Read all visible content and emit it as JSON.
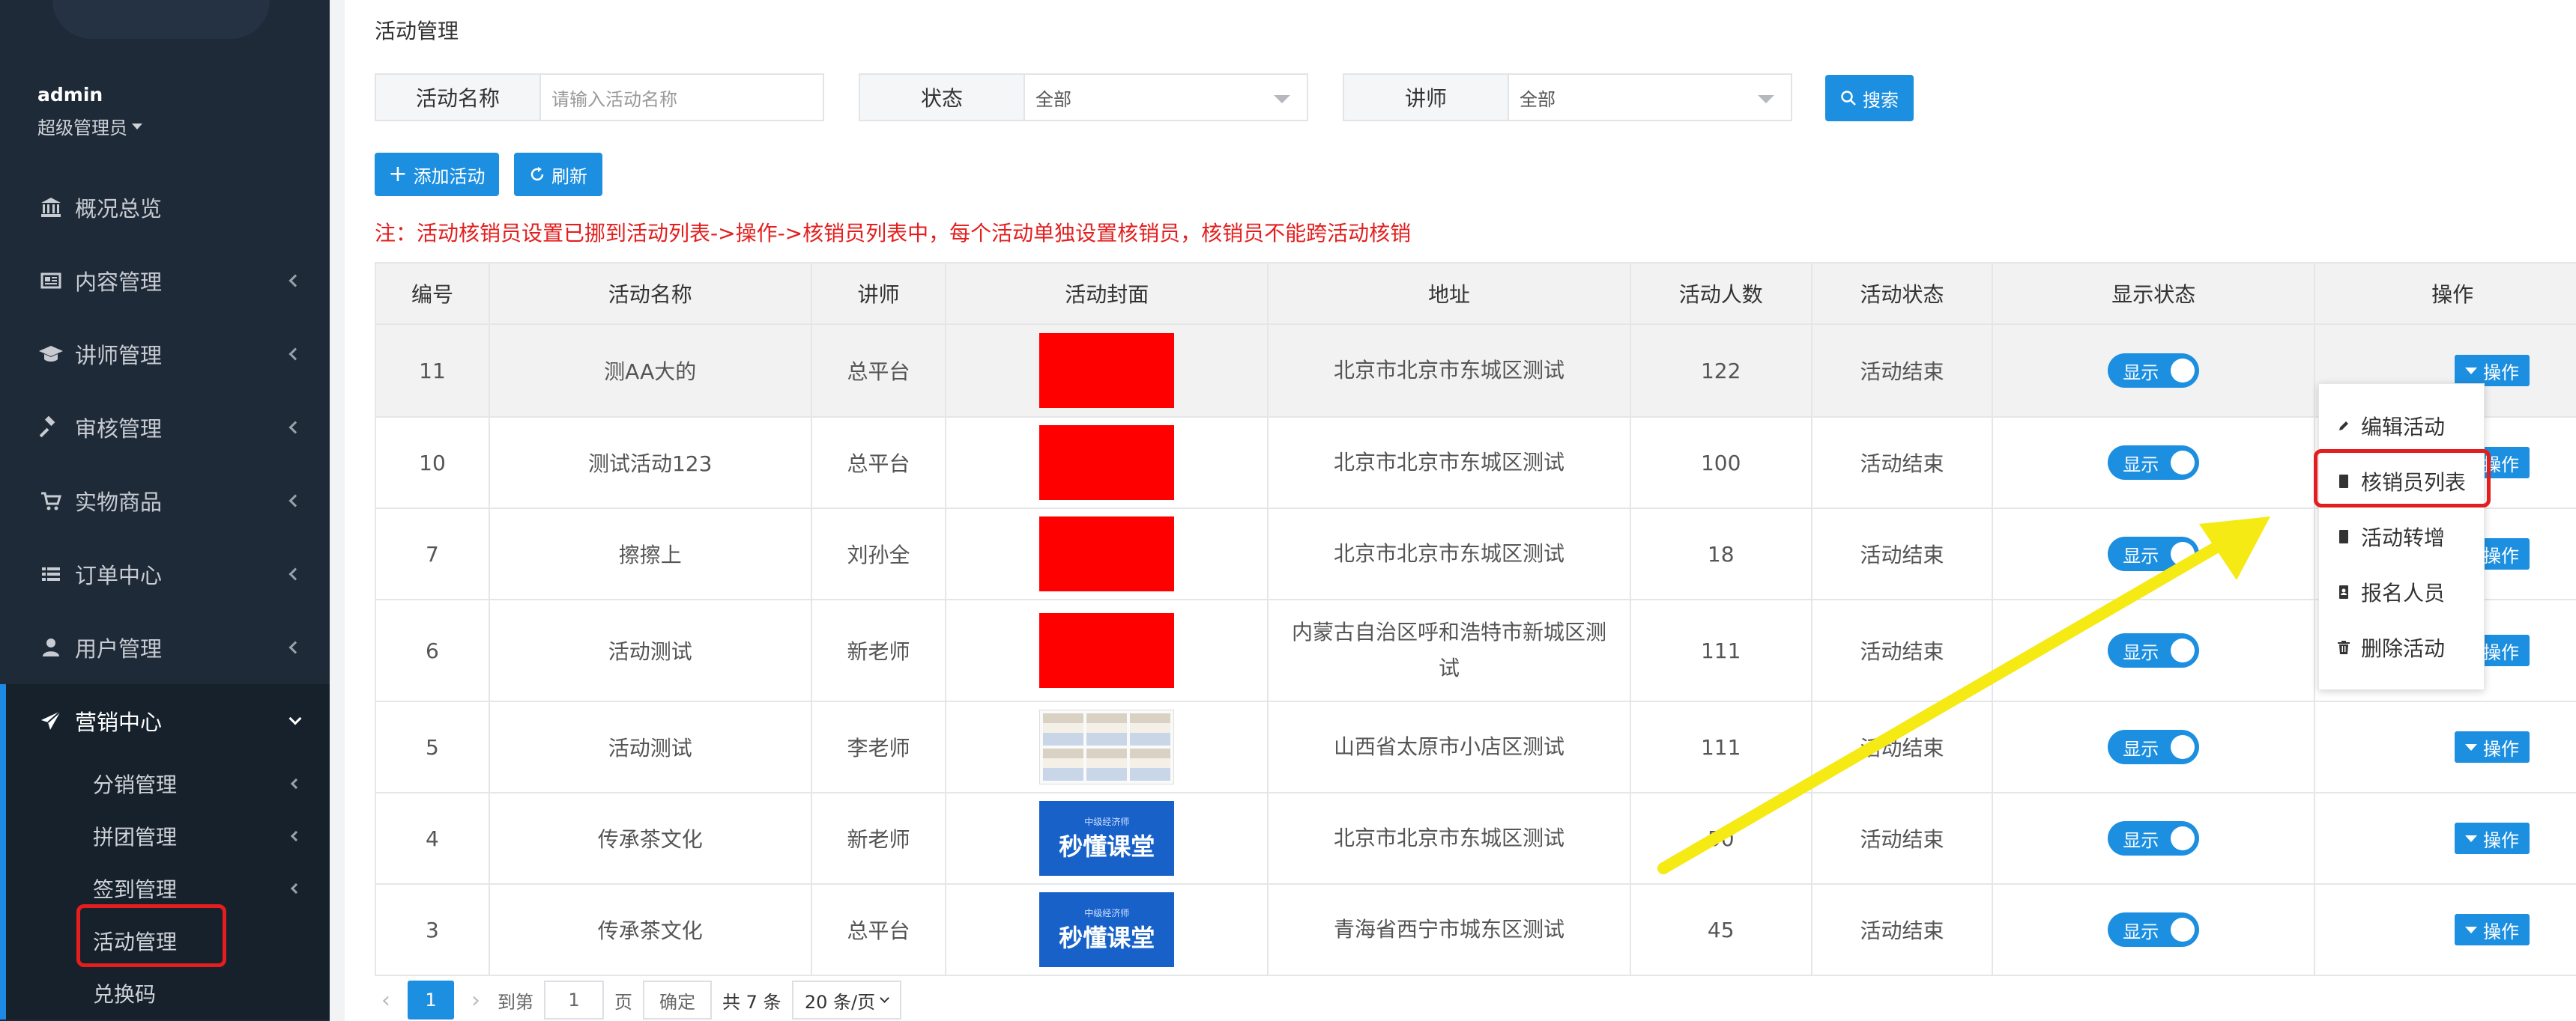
{
  "sidebar": {
    "user": {
      "name": "admin",
      "role": "超级管理员"
    },
    "items": [
      {
        "label": "概况总览",
        "icon": "bank-icon"
      },
      {
        "label": "内容管理",
        "icon": "newspaper-icon"
      },
      {
        "label": "讲师管理",
        "icon": "graduation-cap-icon"
      },
      {
        "label": "审核管理",
        "icon": "gavel-icon"
      },
      {
        "label": "实物商品",
        "icon": "cart-icon"
      },
      {
        "label": "订单中心",
        "icon": "list-icon"
      },
      {
        "label": "用户管理",
        "icon": "user-icon"
      },
      {
        "label": "营销中心",
        "icon": "paper-plane-icon"
      }
    ],
    "sub_items": [
      {
        "label": "分销管理"
      },
      {
        "label": "拼团管理"
      },
      {
        "label": "签到管理"
      },
      {
        "label": "活动管理"
      },
      {
        "label": "兑换码"
      }
    ]
  },
  "page": {
    "title": "活动管理",
    "filters": {
      "name_label": "活动名称",
      "name_placeholder": "请输入活动名称",
      "status_label": "状态",
      "status_value": "全部",
      "lecturer_label": "讲师",
      "lecturer_value": "全部",
      "search_label": "搜索"
    },
    "toolbar": {
      "add_label": "添加活动",
      "refresh_label": "刷新"
    },
    "note": "注：活动核销员设置已挪到活动列表->操作->核销员列表中，每个活动单独设置核销员，核销员不能跨活动核销"
  },
  "table": {
    "headers": [
      "编号",
      "活动名称",
      "讲师",
      "活动封面",
      "地址",
      "活动人数",
      "活动状态",
      "显示状态",
      "操作"
    ],
    "rows": [
      {
        "id": "11",
        "name": "测AA大的",
        "lecturer": "总平台",
        "cover": "red",
        "address": "北京市北京市东城区测试",
        "count": "122",
        "status": "活动结束",
        "display": "显示",
        "op": "操作"
      },
      {
        "id": "10",
        "name": "测试活动123",
        "lecturer": "总平台",
        "cover": "red",
        "address": "北京市北京市东城区测试",
        "count": "100",
        "status": "活动结束",
        "display": "显示",
        "op": "操作"
      },
      {
        "id": "7",
        "name": "擦擦上",
        "lecturer": "刘孙全",
        "cover": "red",
        "address": "北京市北京市东城区测试",
        "count": "18",
        "status": "活动结束",
        "display": "显示",
        "op": "操作"
      },
      {
        "id": "6",
        "name": "活动测试",
        "lecturer": "新老师",
        "cover": "red",
        "address": "内蒙古自治区呼和浩特市新城区测试",
        "count": "111",
        "status": "活动结束",
        "display": "显示",
        "op": "操作"
      },
      {
        "id": "5",
        "name": "活动测试",
        "lecturer": "李老师",
        "cover": "doc",
        "address": "山西省太原市小店区测试",
        "count": "111",
        "status": "活动结束",
        "display": "显示",
        "op": "操作"
      },
      {
        "id": "4",
        "name": "传承茶文化",
        "lecturer": "新老师",
        "cover": "blue",
        "address": "北京市北京市东城区测试",
        "count": "50",
        "status": "活动结束",
        "display": "显示",
        "op": "操作"
      },
      {
        "id": "3",
        "name": "传承茶文化",
        "lecturer": "总平台",
        "cover": "blue",
        "address": "青海省西宁市城东区测试",
        "count": "45",
        "status": "活动结束",
        "display": "显示",
        "op": "操作"
      }
    ],
    "cover_banner": {
      "small": "中级经济师",
      "big": "秒懂课堂"
    }
  },
  "dropdown": {
    "items": [
      {
        "label": "编辑活动",
        "icon": "pencil-icon"
      },
      {
        "label": "核销员列表",
        "icon": "book-icon"
      },
      {
        "label": "活动转增",
        "icon": "book-icon"
      },
      {
        "label": "报名人员",
        "icon": "address-book-icon"
      },
      {
        "label": "删除活动",
        "icon": "trash-icon"
      }
    ]
  },
  "pagination": {
    "current": "1",
    "goto_label": "到第",
    "goto_value": "1",
    "page_label": "页",
    "confirm_label": "确定",
    "total": "共 7 条",
    "page_size": "20 条/页"
  },
  "colors": {
    "accent": "#1c8fe0",
    "highlight": "#e41e1e",
    "arrow": "#f5ea14",
    "sidebar_bg": "#1e2a38"
  }
}
